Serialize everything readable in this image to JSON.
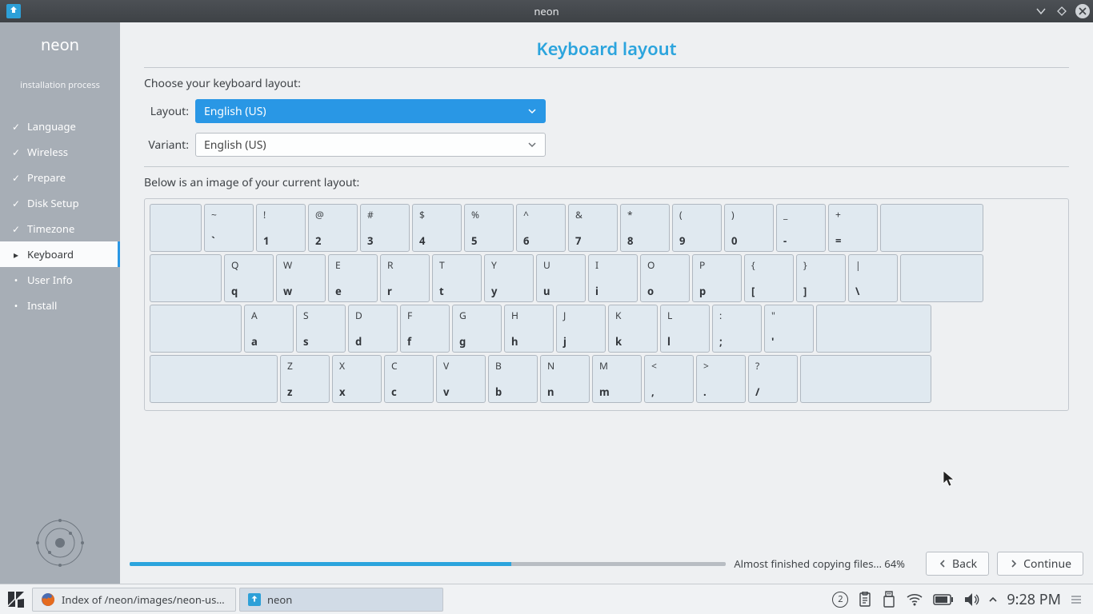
{
  "window": {
    "title": "neon"
  },
  "sidebar": {
    "title": "neon",
    "subtitle": "installation process",
    "steps": [
      {
        "label": "Language",
        "state": "done"
      },
      {
        "label": "Wireless",
        "state": "done"
      },
      {
        "label": "Prepare",
        "state": "done"
      },
      {
        "label": "Disk Setup",
        "state": "done"
      },
      {
        "label": "Timezone",
        "state": "done"
      },
      {
        "label": "Keyboard",
        "state": "active"
      },
      {
        "label": "User Info",
        "state": "todo"
      },
      {
        "label": "Install",
        "state": "todo"
      }
    ]
  },
  "main": {
    "heading": "Keyboard layout",
    "choose_label": "Choose your keyboard layout:",
    "layout_label": "Layout:",
    "variant_label": "Variant:",
    "layout_value": "English (US)",
    "variant_value": "English (US)",
    "preview_label": "Below is an image of your current layout:"
  },
  "keyboard_rows": [
    {
      "lead_w": 65,
      "trail_w": 129,
      "keys": [
        {
          "u": "~",
          "l": "`"
        },
        {
          "u": "!",
          "l": "1"
        },
        {
          "u": "@",
          "l": "2"
        },
        {
          "u": "#",
          "l": "3"
        },
        {
          "u": "$",
          "l": "4"
        },
        {
          "u": "%",
          "l": "5"
        },
        {
          "u": "^",
          "l": "6"
        },
        {
          "u": "&",
          "l": "7"
        },
        {
          "u": "*",
          "l": "8"
        },
        {
          "u": "(",
          "l": "9"
        },
        {
          "u": ")",
          "l": "0"
        },
        {
          "u": "_",
          "l": "-"
        },
        {
          "u": "+",
          "l": "="
        }
      ],
      "key_w": 62
    },
    {
      "lead_w": 90,
      "trail_w": 104,
      "keys": [
        {
          "u": "Q",
          "l": "q"
        },
        {
          "u": "W",
          "l": "w"
        },
        {
          "u": "E",
          "l": "e"
        },
        {
          "u": "R",
          "l": "r"
        },
        {
          "u": "T",
          "l": "t"
        },
        {
          "u": "Y",
          "l": "y"
        },
        {
          "u": "U",
          "l": "u"
        },
        {
          "u": "I",
          "l": "i"
        },
        {
          "u": "O",
          "l": "o"
        },
        {
          "u": "P",
          "l": "p"
        },
        {
          "u": "{",
          "l": "["
        },
        {
          "u": "}",
          "l": "]"
        },
        {
          "u": "|",
          "l": "\\"
        }
      ],
      "key_w": 62
    },
    {
      "lead_w": 115,
      "trail_w": 144,
      "keys": [
        {
          "u": "A",
          "l": "a"
        },
        {
          "u": "S",
          "l": "s"
        },
        {
          "u": "D",
          "l": "d"
        },
        {
          "u": "F",
          "l": "f"
        },
        {
          "u": "G",
          "l": "g"
        },
        {
          "u": "H",
          "l": "h"
        },
        {
          "u": "J",
          "l": "j"
        },
        {
          "u": "K",
          "l": "k"
        },
        {
          "u": "L",
          "l": "l"
        },
        {
          "u": ":",
          "l": ";"
        },
        {
          "u": "\"",
          "l": "'"
        }
      ],
      "key_w": 62
    },
    {
      "lead_w": 160,
      "trail_w": 164,
      "keys": [
        {
          "u": "Z",
          "l": "z"
        },
        {
          "u": "X",
          "l": "x"
        },
        {
          "u": "C",
          "l": "c"
        },
        {
          "u": "V",
          "l": "v"
        },
        {
          "u": "B",
          "l": "b"
        },
        {
          "u": "N",
          "l": "n"
        },
        {
          "u": "M",
          "l": "m"
        },
        {
          "u": "<",
          "l": ","
        },
        {
          "u": ">",
          "l": "."
        },
        {
          "u": "?",
          "l": "/"
        }
      ],
      "key_w": 62
    }
  ],
  "footer": {
    "status": "Almost finished copying files... 64%",
    "progress_pct": 64,
    "back": "Back",
    "continue": "Continue"
  },
  "taskbar": {
    "items": [
      {
        "label": "Index of /neon/images/neon-usered",
        "icon": "firefox"
      },
      {
        "label": "neon",
        "icon": "installer",
        "active": true
      }
    ],
    "updates": "2",
    "time": "9:28 PM"
  }
}
